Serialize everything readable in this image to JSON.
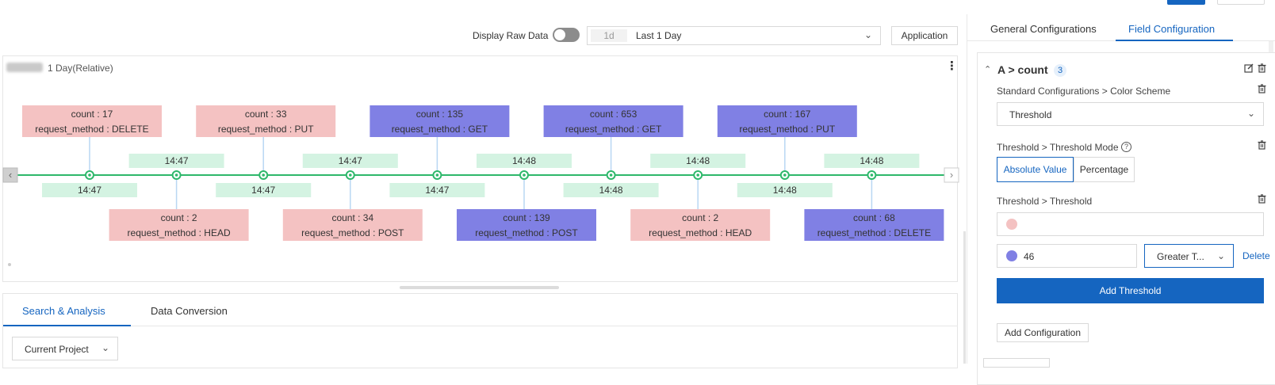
{
  "toolbar": {
    "display_raw_label": "Display Raw Data",
    "raw_toggle_on": false,
    "time_badge": "1d",
    "time_value": "Last 1 Day",
    "apply_label": "Application"
  },
  "panel": {
    "time_range": "1 Day(Relative)"
  },
  "timeline": {
    "colors": {
      "line": "#2eb86b",
      "time_bg": "#d4f3e2",
      "low": "#f4c2c2",
      "high": "#8080e4",
      "connector": "#b9d7f3"
    },
    "events": [
      {
        "time": "14:47",
        "count": "count : 17",
        "method": "request_method : DELETE",
        "level": "low"
      },
      {
        "time": "14:47",
        "count": "count : 2",
        "method": "request_method : HEAD",
        "level": "low"
      },
      {
        "time": "14:47",
        "count": "count : 33",
        "method": "request_method : PUT",
        "level": "low"
      },
      {
        "time": "14:47",
        "count": "count : 34",
        "method": "request_method : POST",
        "level": "low"
      },
      {
        "time": "14:47",
        "count": "count : 135",
        "method": "request_method : GET",
        "level": "high"
      },
      {
        "time": "14:48",
        "count": "count : 139",
        "method": "request_method : POST",
        "level": "high"
      },
      {
        "time": "14:48",
        "count": "count : 653",
        "method": "request_method : GET",
        "level": "high"
      },
      {
        "time": "14:48",
        "count": "count : 2",
        "method": "request_method : HEAD",
        "level": "low"
      },
      {
        "time": "14:48",
        "count": "count : 167",
        "method": "request_method : PUT",
        "level": "high"
      },
      {
        "time": "14:48",
        "count": "count : 68",
        "method": "request_method : DELETE",
        "level": "high"
      }
    ]
  },
  "bottom_tabs": [
    "Search & Analysis",
    "Data Conversion"
  ],
  "project_select": "Current Project",
  "right_panel": {
    "tabs": [
      "General Configurations",
      "Field Configuration"
    ],
    "section_title": "A > count",
    "section_count": "3",
    "color_scheme_label": "Standard Configurations > Color Scheme",
    "color_scheme_value": "Threshold",
    "mode_label": "Threshold > Threshold Mode",
    "mode_help": "?",
    "mode_options": [
      "Absolute Value",
      "Percentage"
    ],
    "threshold_label": "Threshold > Threshold",
    "base_color": "#f4c2c2",
    "step_color": "#8080e4",
    "step_value": "46",
    "operator": "Greater T...",
    "delete_label": "Delete",
    "add_threshold_label": "Add Threshold",
    "add_config_label": "Add Configuration"
  }
}
